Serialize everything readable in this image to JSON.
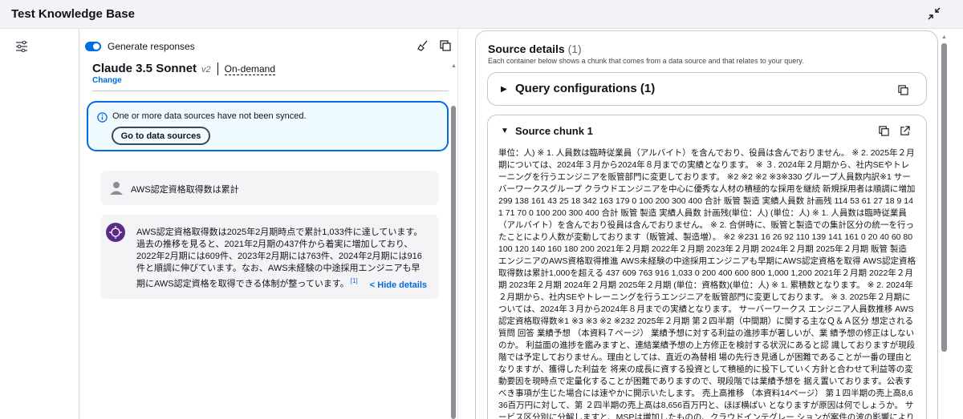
{
  "header": {
    "title": "Test Knowledge Base",
    "collapse_icon": "collapse-icon"
  },
  "sidebar": {
    "menu_icon": "sliders-icon"
  },
  "chat": {
    "generate_label": "Generate responses",
    "generate_enabled": true,
    "model_name": "Claude 3.5 Sonnet",
    "model_version": "v2",
    "throughput": "On-demand",
    "change_label": "Change",
    "alert": {
      "message": "One or more data sources have not been synced.",
      "button_label": "Go to data sources"
    },
    "user_message": "AWS認定資格取得数は累計",
    "bot_message": "AWS認定資格取得数は2025年2月期時点で累計1,033件に達しています。過去の推移を見ると、2021年2月期の437件から着実に増加しており、2022年2月期には609件、2023年2月期には763件、2024年2月期には916件と順調に伸びています。なお、AWS未経験の中途採用エンジニアも早期にAWS認定資格を取得できる体制が整っています。",
    "citation": "[1]",
    "hide_details_label": "< Hide details"
  },
  "source": {
    "title": "Source details",
    "count": "(1)",
    "description": "Each container below shows a chunk that comes from a data source and that relates to your query.",
    "query_config_label": "Query configurations (1)",
    "chunk_label": "Source chunk 1",
    "chunk_text": "単位：人) ※ 1. 人員数は臨時従業員（アルバイト）を含んでおり、役員は含んでおりません。 ※ 2. 2025年２月期については、2024年３月から2024年８月までの実績となります。 ※ ３. 2024年２月期から、社内SEやトレーニングを行うエンジニアを販管部門に変更しております。 ※2 ※2 ※2 ※3※330 グループ人員数内訳※1 サーバーワークスグループ クラウドエンジニアを中心に優秀な人材の積極的な採用を継続 新規採用者は順調に増加 299 138 161 43 25 18 342 163 179 0 100 200 300 400 合計 販管 製造 実績人員数 計画残 114 53 61 27 18 9 141 71 70 0 100 200 300 400 合計 販管 製造 実績人員数 計画残(単位：人) (単位：人) ※ 1. 人員数は臨時従業員（アルバイト）を含んでおり役員は含んでおりません。 ※ 2. 合併時に、販管と製造での集計区分の統一を行ったことにより人数が変動しております（販管減、製造増）。 ※2 ※231 16 26 92 110 139 141 161 0 20 40 60 80 100 120 140 160 180 200 2021年２月期 2022年２月期 2023年２月期 2024年２月期 2025年２月期 販管 製造 エンジニアのAWS資格取得推進 AWS未経験の中途採用エンジニアも早期にAWS認定資格を取得 AWS認定資格取得数は累計1,000を超える 437 609 763 916 1,033 0 200 400 600 800 1,000 1,200 2021年２月期 2022年２月期 2023年２月期 2024年２月期 2025年２月期 (単位：資格数)(単位：人) ※ 1. 累積数となります。 ※ 2. 2024年２月期から、社内SEやトレーニングを行うエンジニアを販管部門に変更しております。 ※ 3. 2025年２月期については、2024年３月から2024年８月までの実績となります。 サーバーワークス エンジニア人員数推移 AWS認定資格取得数※1 ※3 ※3 ※2 ※232 2025年２月期 第２四半期（中間期）に関する主なＱ＆Ａ区分 想定される質問 回答 業績予想 （本資料７ページ） 業績予想に対する利益の進捗率が著しいが、業 績予想の修正はしないのか。 利益面の進捗を鑑みますと、連結業績予想の上方修正を検討する状況にあると認 識しておりますが現段階では予定しておりません。理由としては、直近の為替相 場の先行き見通しが困難であることが一番の理由となりますが、獲得した利益を 将来の成長に資する投資として積極的に投下していく方針と合わせて利益等の変 動要因を現時点で定量化することが困難でありますので、現段階では業績予想を 据え置いております。公表すべき事項が生じた場合には速やかに開示いたします。 売上高推移 （本資料14ページ） 第１四半期の売上高8,636百万円に対して、第 ２四半期の売上高は8,656百万円と、ほぼ横ばい となりますが原因は何でしょうか。 サービス区分別に分解しますと、MSPは増加したものの、クラウドインテグレー ションが案件の波の影響により"
  }
}
